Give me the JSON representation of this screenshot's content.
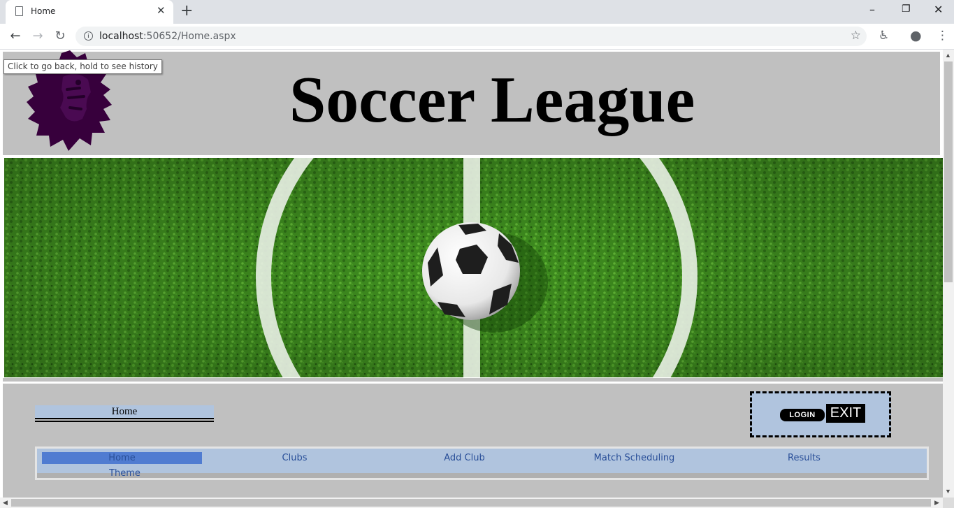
{
  "browser": {
    "tab_title": "Home",
    "url_host": "localhost",
    "url_rest": ":50652/Home.aspx",
    "tooltip": "Click to go back, hold to see history"
  },
  "header": {
    "site_title": "Soccer League",
    "logo": "premier-league-lion-logo",
    "logo_color": "#37003c",
    "background_color": "#c0c0c0"
  },
  "hero": {
    "image": "soccer-ball-on-grass-center-circle"
  },
  "breadcrumb": {
    "current": "Home"
  },
  "auth": {
    "login_label": "LOGIN",
    "exit_label": "EXIT"
  },
  "menu": {
    "items": [
      {
        "label": "Home",
        "active": true
      },
      {
        "label": "Clubs",
        "active": false
      },
      {
        "label": "Add Club",
        "active": false
      },
      {
        "label": "Match Scheduling",
        "active": false
      },
      {
        "label": "Results",
        "active": false
      },
      {
        "label": "Theme",
        "active": false
      }
    ],
    "active_color": "#507cd1",
    "background_color": "#b0c4de",
    "text_color": "#284e98"
  }
}
